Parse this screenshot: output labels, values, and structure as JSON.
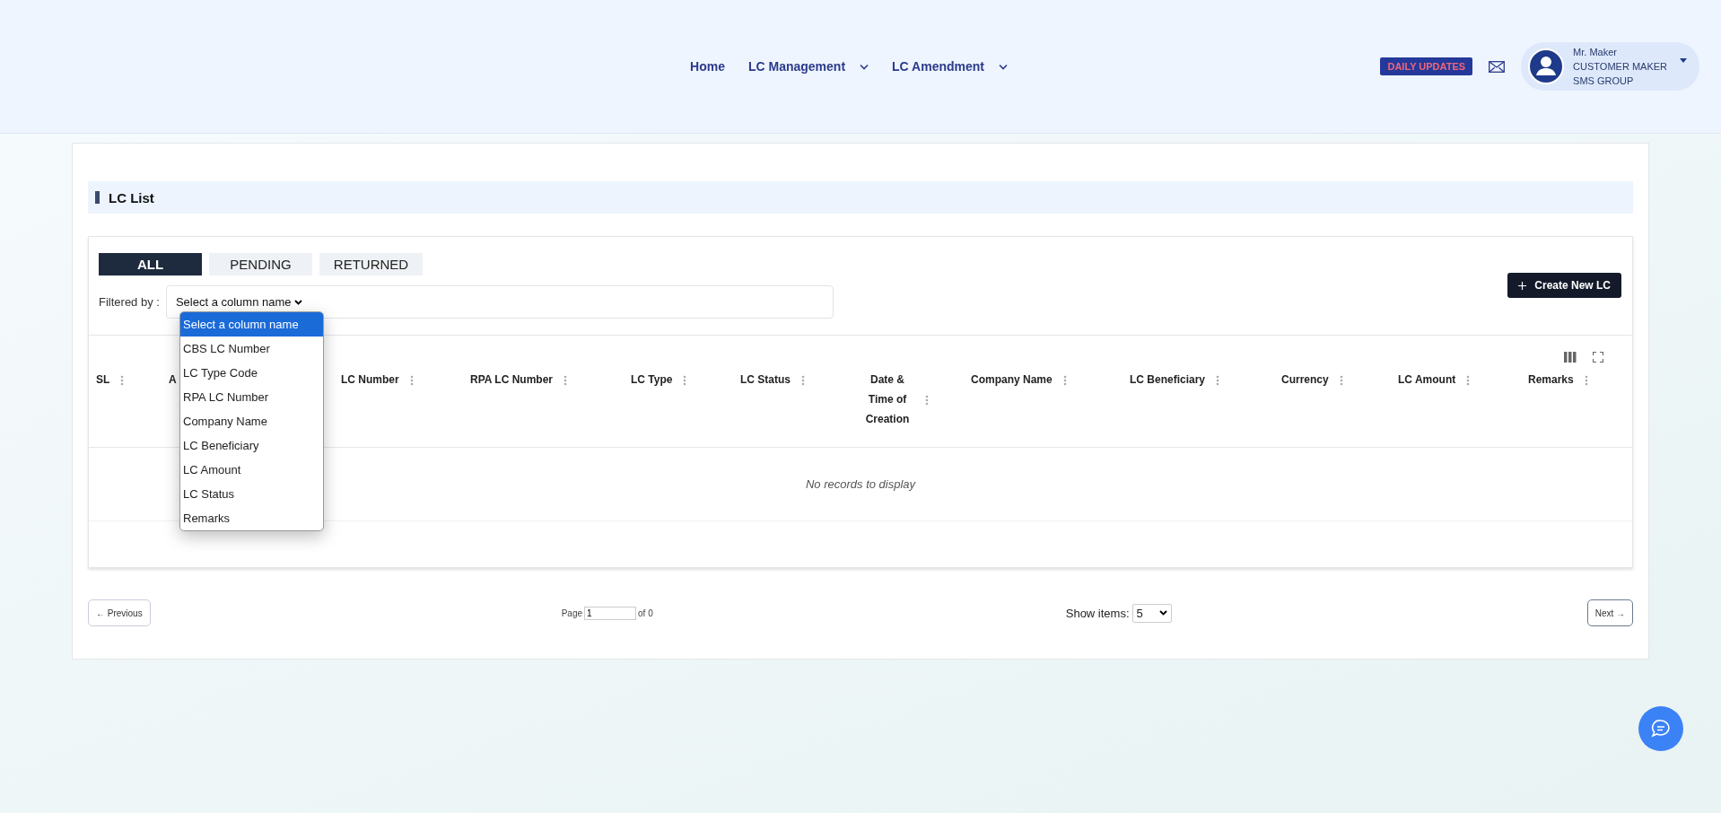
{
  "nav": {
    "links": [
      {
        "label": "Home",
        "dropdown": false
      },
      {
        "label": "LC Management",
        "dropdown": true
      },
      {
        "label": "LC Amendment",
        "dropdown": true
      }
    ]
  },
  "header": {
    "daily_updates": "DAILY UPDATES",
    "user": {
      "name": "Mr. Maker",
      "role": "CUSTOMER MAKER",
      "group": "SMS GROUP"
    }
  },
  "page": {
    "title": "LC List"
  },
  "tabs": [
    {
      "label": "ALL",
      "selected": true
    },
    {
      "label": "PENDING",
      "selected": false
    },
    {
      "label": "RETURNED",
      "selected": false
    }
  ],
  "filter": {
    "label": "Filtered by :",
    "select": {
      "value": "Select a column name",
      "expanded": true,
      "options": [
        {
          "label": "Select a column name",
          "selected": true
        },
        {
          "label": "CBS LC Number",
          "selected": false
        },
        {
          "label": "LC Type Code",
          "selected": false
        },
        {
          "label": "RPA LC Number",
          "selected": false
        },
        {
          "label": "Company Name",
          "selected": false
        },
        {
          "label": "LC Beneficiary",
          "selected": false
        },
        {
          "label": "LC Amount",
          "selected": false
        },
        {
          "label": "LC Status",
          "selected": false
        },
        {
          "label": "Remarks",
          "selected": false
        }
      ]
    }
  },
  "create_button": {
    "label": "Create New LC"
  },
  "table": {
    "columns": [
      {
        "label": "SL",
        "menu_icon": true
      },
      {
        "label": "A",
        "menu_icon": false
      },
      {
        "label": "LC Number",
        "menu_icon": true
      },
      {
        "label": "RPA LC Number",
        "menu_icon": true
      },
      {
        "label": "LC Type",
        "menu_icon": true
      },
      {
        "label": "LC Status",
        "menu_icon": true
      },
      {
        "label": "Date & Time of Creation",
        "menu_icon": true
      },
      {
        "label": "Company Name",
        "menu_icon": true
      },
      {
        "label": "LC Beneficiary",
        "menu_icon": true
      },
      {
        "label": "Currency",
        "menu_icon": true
      },
      {
        "label": "LC Amount",
        "menu_icon": true
      },
      {
        "label": "Remarks",
        "menu_icon": true
      }
    ],
    "empty_message": "No records to display"
  },
  "pagination": {
    "previous": "← Previous",
    "page_label": "Page",
    "page_value": "1",
    "of_label": "of 0",
    "show_items_label": "Show items:",
    "show_items_value": "5",
    "next": "Next →"
  }
}
